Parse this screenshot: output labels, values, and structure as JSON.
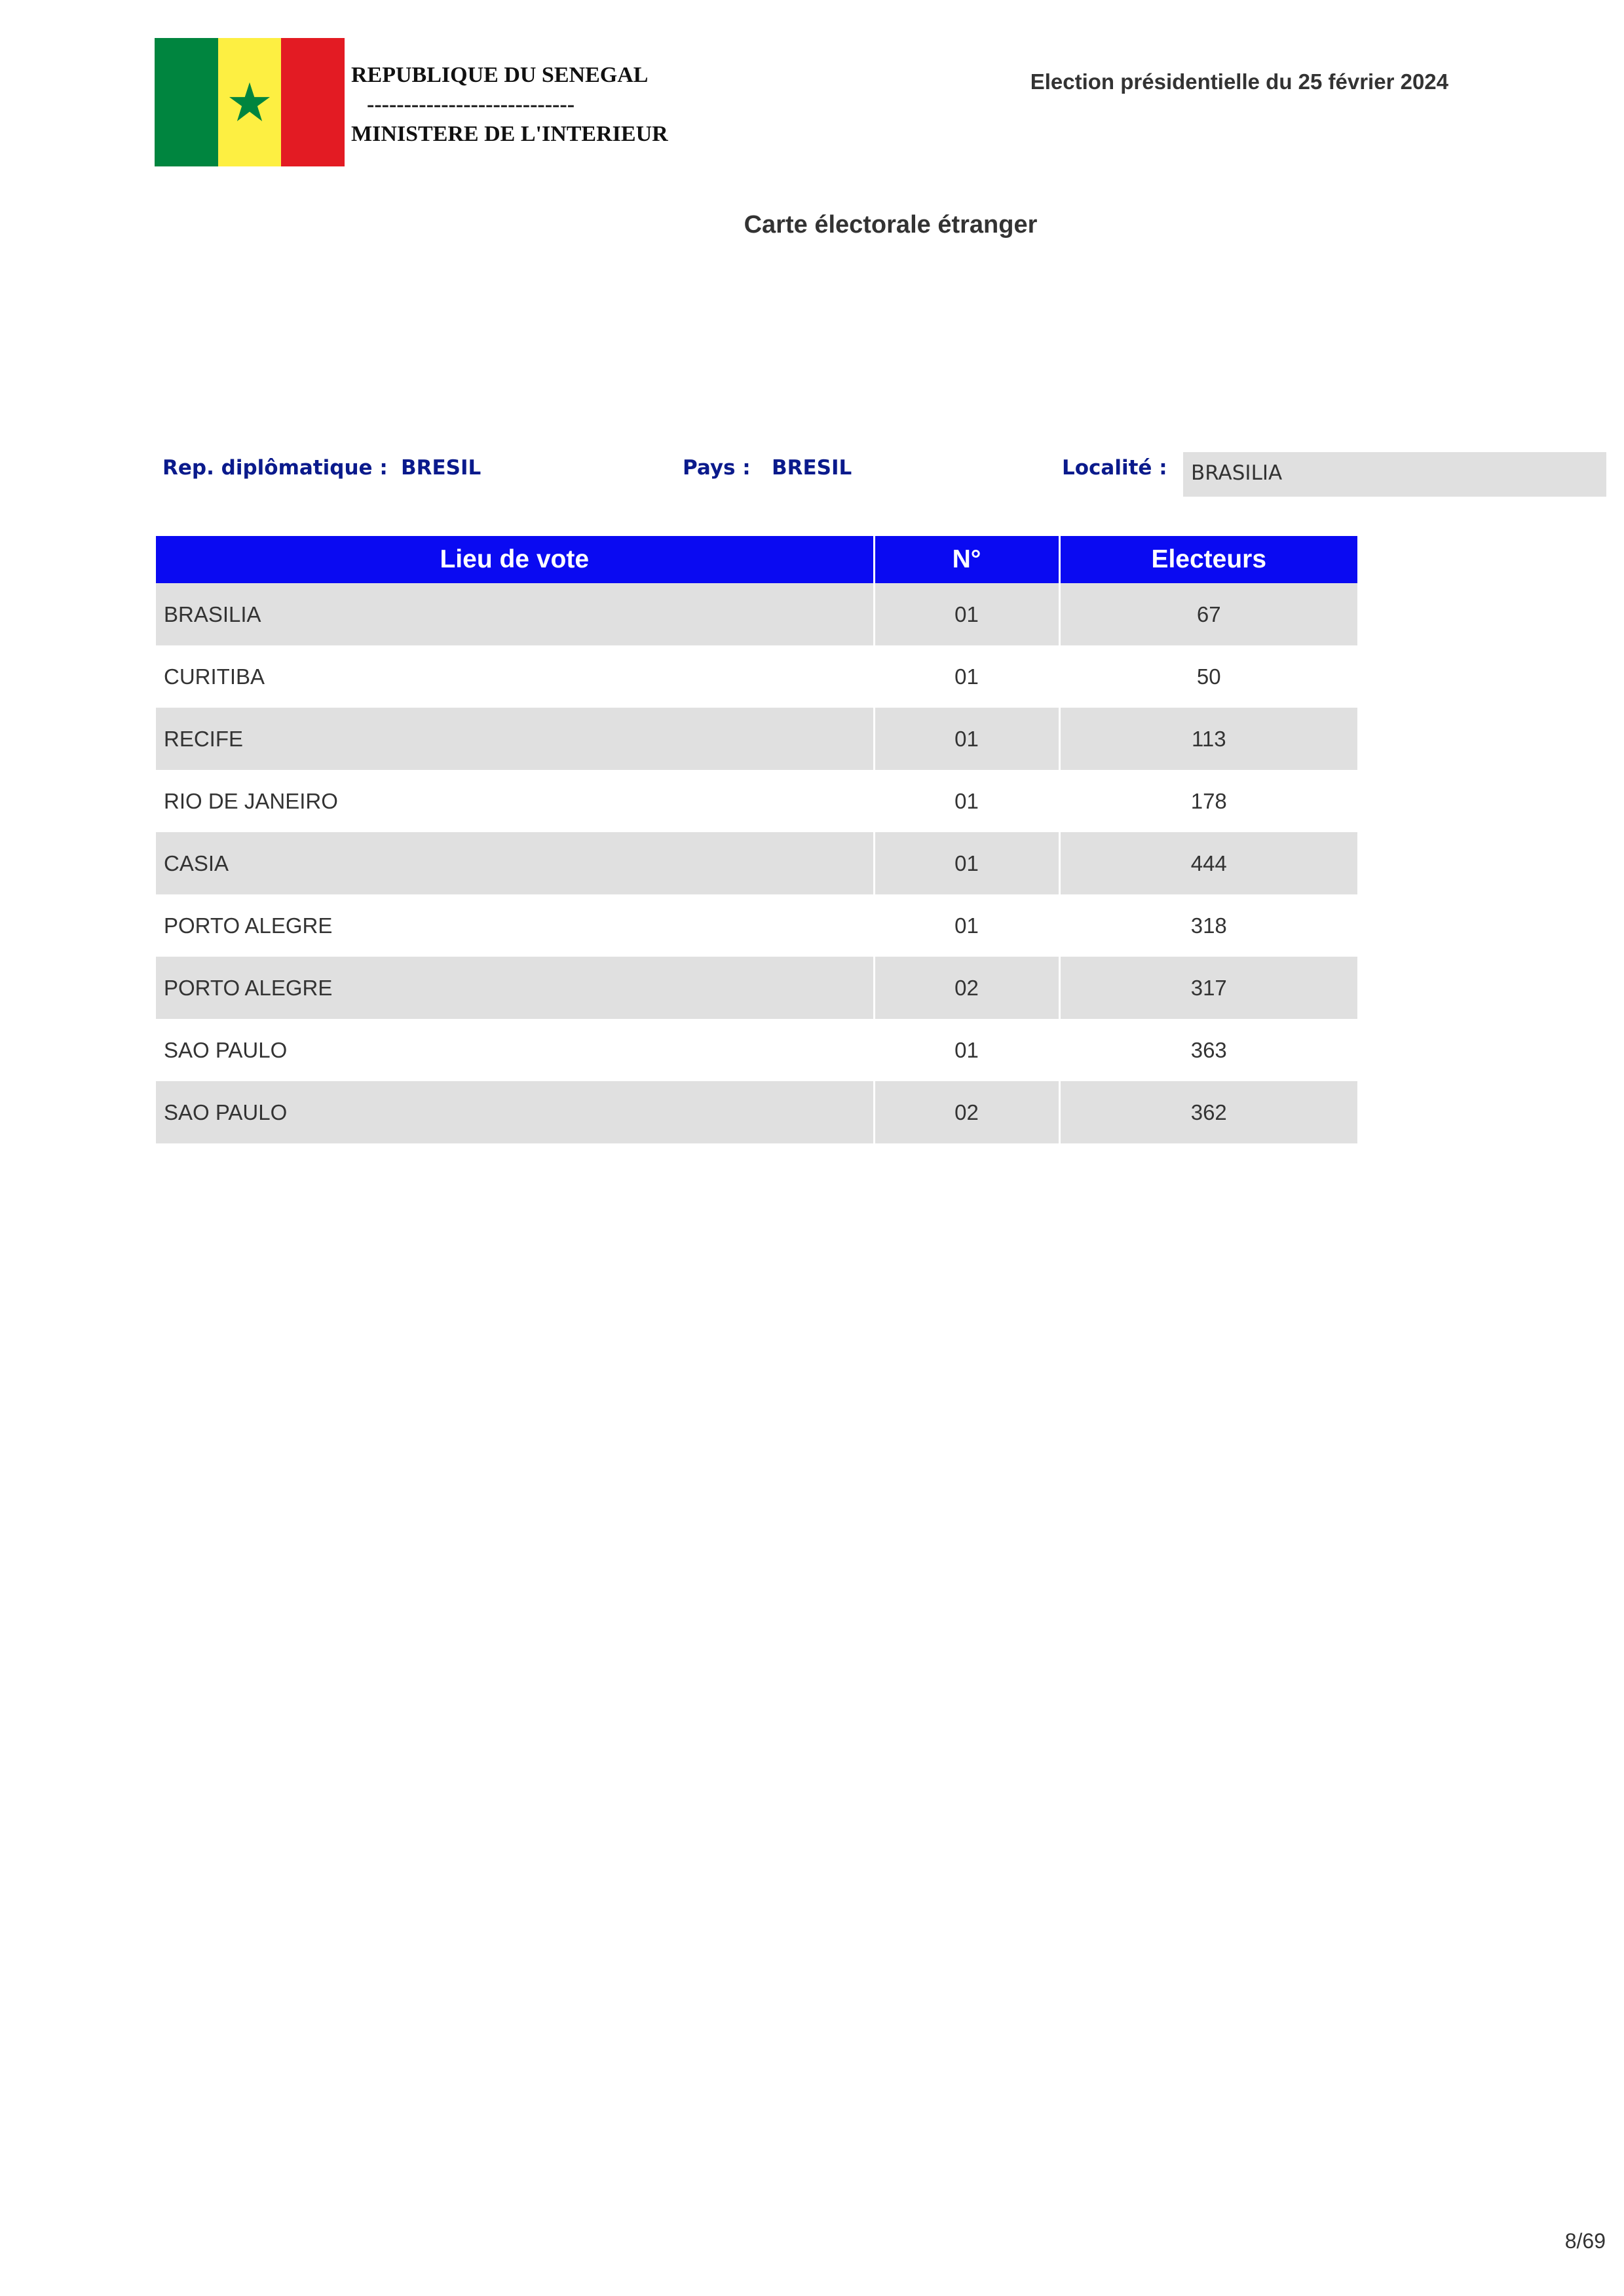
{
  "header": {
    "country": "REPUBLIQUE DU SENEGAL",
    "separator": "----------------------------",
    "ministry": "MINISTERE DE L'INTERIEUR",
    "election": "Election présidentielle du 25 février 2024"
  },
  "flag": {
    "icon": "senegal-flag-icon",
    "colors": [
      "#00853f",
      "#fdef42",
      "#e31b23"
    ],
    "star_color": "#00853f"
  },
  "document": {
    "title": "Carte électorale étranger"
  },
  "meta": {
    "rep_label": "Rep. diplômatique :",
    "rep_value": "BRESIL",
    "pays_label": "Pays :",
    "pays_value": "BRESIL",
    "localite_label": "Localité :",
    "localite_value": "BRASILIA"
  },
  "table": {
    "headers": [
      "Lieu de vote",
      "N°",
      "Electeurs"
    ],
    "rows": [
      {
        "place": "BRASILIA",
        "num": "01",
        "count": "67"
      },
      {
        "place": "CURITIBA",
        "num": "01",
        "count": "50"
      },
      {
        "place": "RECIFE",
        "num": "01",
        "count": "113"
      },
      {
        "place": "RIO DE JANEIRO",
        "num": "01",
        "count": "178"
      },
      {
        "place": "CASIA",
        "num": "01",
        "count": "444"
      },
      {
        "place": "PORTO ALEGRE",
        "num": "01",
        "count": "318"
      },
      {
        "place": "PORTO ALEGRE",
        "num": "02",
        "count": "317"
      },
      {
        "place": "SAO PAULO",
        "num": "01",
        "count": "363"
      },
      {
        "place": "SAO PAULO",
        "num": "02",
        "count": "362"
      }
    ]
  },
  "colors": {
    "header_blue": "#0a0af2",
    "label_navy": "#0a1a8c",
    "row_shade": "#e0e0e0"
  },
  "footer": {
    "page": "8/69"
  }
}
